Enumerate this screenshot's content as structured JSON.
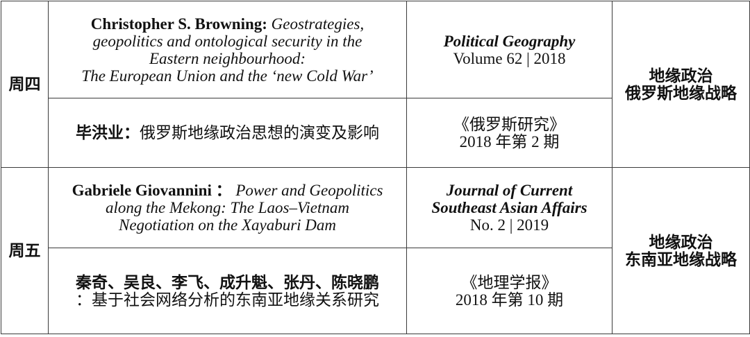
{
  "rows": [
    {
      "day": "周四",
      "topic": [
        "地缘政治",
        "俄罗斯地缘战略"
      ],
      "papers": [
        {
          "author": "Christopher S. Browning:",
          "title_lines": [
            "Geostrategies,",
            "geopolitics and ontological security in the",
            "Eastern neighbourhood:",
            "The European Union and the ‘new Cold War’"
          ],
          "journal_lines": [
            "Political Geography"
          ],
          "issue": "Volume 62 | 2018"
        },
        {
          "author": "毕洪业：",
          "title": "俄罗斯地缘政治思想的演变及影响",
          "journal_lines": [
            "《俄罗斯研究》"
          ],
          "issue": "2018 年第 2 期"
        }
      ]
    },
    {
      "day": "周五",
      "topic": [
        "地缘政治",
        "东南亚地缘战略"
      ],
      "papers": [
        {
          "author": "Gabriele Giovannini ：",
          "title_lines": [
            "Power and Geopolitics",
            "along the Mekong: The Laos–Vietnam",
            "Negotiation on the Xayaburi Dam"
          ],
          "journal_lines": [
            "Journal of Current",
            "Southeast Asian Affairs"
          ],
          "issue": "No. 2 | 2019"
        },
        {
          "author": "秦奇、吴良、李飞、成升魁、张丹、陈晓鹏",
          "title": "：基于社会网络分析的东南亚地缘关系研究",
          "journal_lines": [
            "《地理学报》"
          ],
          "issue": "2018 年第 10 期"
        }
      ]
    }
  ]
}
